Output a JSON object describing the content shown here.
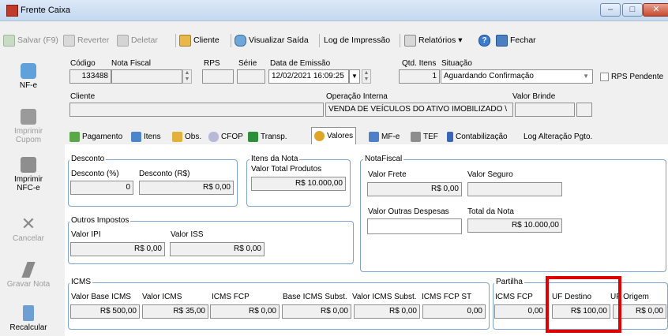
{
  "window": {
    "title": "Frente Caixa",
    "controls": {
      "minimize": "–",
      "maximize": "□",
      "close": "✕"
    }
  },
  "toolbar": {
    "save": "Salvar (F9)",
    "revert": "Reverter",
    "delete": "Deletar",
    "client": "Cliente",
    "view_output": "Visualizar Saída",
    "print_log": "Log de Impressão",
    "reports": "Relatórios",
    "reports_arrow": "▾",
    "help": "?",
    "close": "Fechar"
  },
  "sidebar": {
    "nfe": "NF-e",
    "print_coupon": "Imprimir Cupom",
    "print_nfce": "Imprimir NFC-e",
    "cancel": "Cancelar",
    "save_note": "Gravar Nota",
    "recalculate": "Recalcular"
  },
  "header": {
    "codigo_label": "Código",
    "codigo_value": "133488",
    "nota_fiscal_label": "Nota Fiscal",
    "nota_fiscal_value": "",
    "rps_label": "RPS",
    "rps_value": "",
    "serie_label": "Série",
    "serie_value": "",
    "data_emissao_label": "Data de Emissão",
    "data_emissao_value": "12/02/2021 16:09:25",
    "qtd_itens_label": "Qtd. Itens",
    "qtd_itens_value": "1",
    "situacao_label": "Situação",
    "situacao_value": "Aguardando Confirmação",
    "rps_pendente_label": "RPS Pendente",
    "cliente_label": "Cliente",
    "cliente_value": "",
    "operacao_label": "Operação Interna",
    "operacao_value": "VENDA DE VEÍCULOS DO ATIVO IMOBILIZADO \\",
    "valor_brinde_label": "Valor Brinde",
    "valor_brinde_value": ""
  },
  "tabs": [
    "Pagamento",
    "Itens",
    "Obs.",
    "CFOP",
    "Transp.",
    "Valores",
    "MF-e",
    "TEF",
    "Contabilização",
    "Log Alteração Pgto."
  ],
  "active_tab": "Valores",
  "desconto": {
    "title": "Desconto",
    "pct_label": "Desconto (%)",
    "pct_value": "0",
    "rs_label": "Desconto (R$)",
    "rs_value": "R$ 0,00"
  },
  "itens_nota": {
    "title": "Itens da Nota",
    "label": "Valor Total Produtos",
    "value": "R$ 10.000,00"
  },
  "nota_fiscal": {
    "title": "NotaFiscal",
    "frete_label": "Valor Frete",
    "frete_value": "R$ 0,00",
    "seguro_label": "Valor Seguro",
    "seguro_value": "",
    "outras_label": "Valor Outras Despesas",
    "outras_value": "",
    "total_label": "Total da Nota",
    "total_value": "R$ 10.000,00"
  },
  "outros_impostos": {
    "title": "Outros Impostos",
    "ipi_label": "Valor IPI",
    "ipi_value": "R$ 0,00",
    "iss_label": "Valor ISS",
    "iss_value": "R$ 0,00"
  },
  "icms": {
    "title": "ICMS",
    "base_label": "Valor Base ICMS",
    "base_value": "R$ 500,00",
    "valor_label": "Valor ICMS",
    "valor_value": "R$ 35,00",
    "fcp_label": "ICMS FCP",
    "fcp_value": "R$ 0,00",
    "base_subst_label": "Base ICMS Subst.",
    "base_subst_value": "R$ 0,00",
    "valor_subst_label": "Valor ICMS Subst.",
    "valor_subst_value": "R$ 0,00",
    "fcp_st_label": "ICMS FCP ST",
    "fcp_st_value": "0,00"
  },
  "partilha": {
    "title": "Partilha",
    "fcp_label": "ICMS FCP",
    "fcp_value": "0,00",
    "uf_destino_label": "UF Destino",
    "uf_destino_value": "R$ 100,00",
    "uf_origem_label": "UF Origem",
    "uf_origem_value": "R$ 0,00"
  },
  "highlight_color": "#e00000"
}
